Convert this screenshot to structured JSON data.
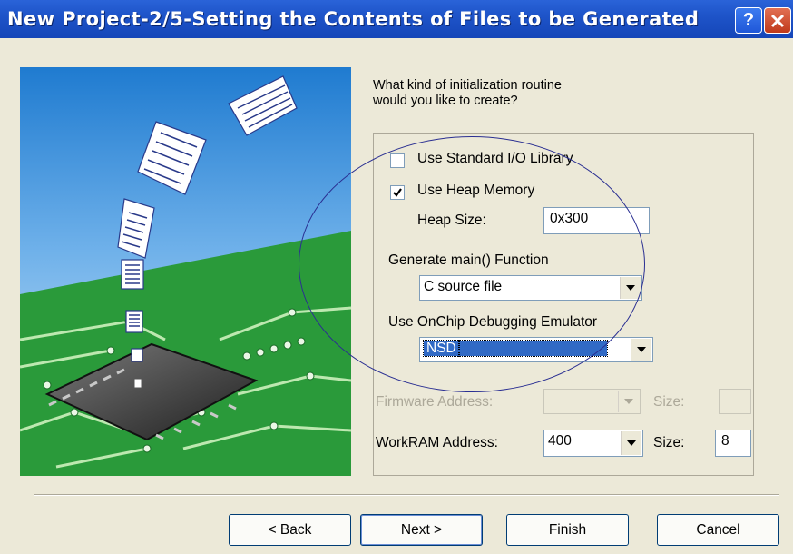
{
  "window": {
    "title": "New Project-2/5-Setting the Contents of Files to be Generated",
    "help_icon": "help-icon",
    "close_icon": "close-icon",
    "accent": "#1e54c9"
  },
  "prompt": {
    "line1": "What kind of initialization routine",
    "line2": "would you like to create?"
  },
  "options": {
    "std_io": {
      "label": "Use Standard I/O Library",
      "checked": false
    },
    "heap": {
      "label": "Use Heap Memory",
      "checked": true
    },
    "heap_size_label": "Heap Size:",
    "heap_size_value": "0x300",
    "main_label": "Generate main() Function",
    "main_value": "C source file",
    "emulator_label": "Use OnChip Debugging Emulator",
    "emulator_value": "NSD",
    "firmware_label": "Firmware Address:",
    "firmware_value": "",
    "firmware_size_label": "Size:",
    "firmware_size_value": "",
    "workram_label": "WorkRAM Address:",
    "workram_value": "400",
    "workram_size_label": "Size:",
    "workram_size_value": "8"
  },
  "buttons": {
    "back": "< Back",
    "next": "Next >",
    "finish": "Finish",
    "cancel": "Cancel"
  }
}
